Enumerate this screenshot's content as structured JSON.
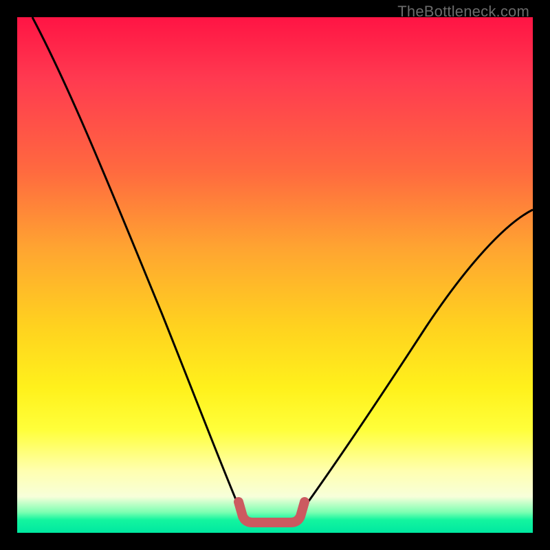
{
  "watermark": "TheBottleneck.com",
  "colors": {
    "frame": "#000000",
    "gradient_top": "#ff1444",
    "gradient_mid1": "#ffa531",
    "gradient_mid2": "#fff11c",
    "gradient_bottom": "#00e8a0",
    "curve": "#000000",
    "trough_marker": "#cc5a60"
  },
  "chart_data": {
    "type": "line",
    "title": "",
    "xlabel": "",
    "ylabel": "",
    "xlim": [
      0,
      100
    ],
    "ylim": [
      0,
      100
    ],
    "series": [
      {
        "name": "left-branch",
        "x": [
          3,
          8,
          14,
          20,
          26,
          32,
          38,
          43
        ],
        "y": [
          100,
          88,
          74,
          60,
          44,
          28,
          12,
          4
        ]
      },
      {
        "name": "right-branch",
        "x": [
          55,
          60,
          66,
          72,
          78,
          85,
          92,
          100
        ],
        "y": [
          4,
          10,
          18,
          27,
          36,
          46,
          55,
          62
        ]
      },
      {
        "name": "trough-marker",
        "x": [
          43,
          44,
          45,
          46,
          52,
          53,
          54,
          55
        ],
        "y": [
          4,
          2,
          1,
          1,
          1,
          1,
          2,
          4
        ]
      }
    ],
    "annotations": [
      {
        "text": "TheBottleneck.com",
        "pos": "top-right"
      }
    ]
  }
}
